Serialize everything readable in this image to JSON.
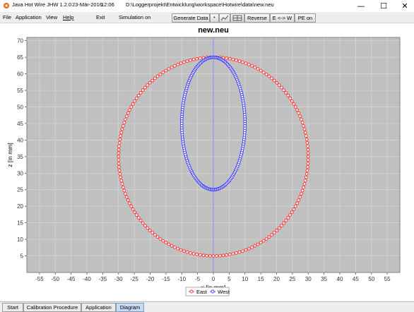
{
  "window": {
    "app_name": "Java Hot Wire JHW 1.2.0",
    "date": "23-Mär-2016",
    "time": "12:06",
    "path": "D:\\Loggerprojekt\\Entwicklung\\workspace\\Hotwire\\data\\new.neu",
    "minimize": "—",
    "maximize": "☐",
    "close": "✕"
  },
  "menu": {
    "file": "File",
    "application": "Application",
    "view": "View",
    "help": "Help",
    "exit": "Exit",
    "simulation": "Simulation on"
  },
  "toolbar": {
    "generate": "Generate Data",
    "star": "*",
    "reverse": "Reverse",
    "east_west": "E <-> W",
    "pe": "PE on"
  },
  "tabs": {
    "start": "Start",
    "calibration": "Calibration Procedure",
    "application": "Application",
    "diagram": "Diagram",
    "active": "Diagram"
  },
  "chart_data": {
    "type": "scatter",
    "title": "new.neu",
    "xlabel": "x [in mm]",
    "ylabel": "z [in mm]",
    "xlim": [
      -59,
      59
    ],
    "ylim": [
      0,
      71
    ],
    "xticks": [
      -55,
      -50,
      -45,
      -40,
      -35,
      -30,
      -25,
      -20,
      -15,
      -10,
      -5,
      0,
      5,
      10,
      15,
      20,
      25,
      30,
      35,
      40,
      45,
      50,
      55
    ],
    "yticks": [
      5,
      10,
      15,
      20,
      25,
      30,
      35,
      40,
      45,
      50,
      55,
      60,
      65,
      70
    ],
    "grid": true,
    "legend_position": "bottom-center",
    "background": "#c0c0c0",
    "series": [
      {
        "name": "East",
        "color": "#ff2a2a",
        "shape": "ellipse",
        "center": [
          0,
          35
        ],
        "radius_x": 30,
        "radius_z": 30,
        "points": 180
      },
      {
        "name": "West",
        "color": "#3333ff",
        "shape": "ellipse",
        "center": [
          0,
          45
        ],
        "radius_x": 10,
        "radius_z": 20,
        "points": 180
      }
    ]
  }
}
